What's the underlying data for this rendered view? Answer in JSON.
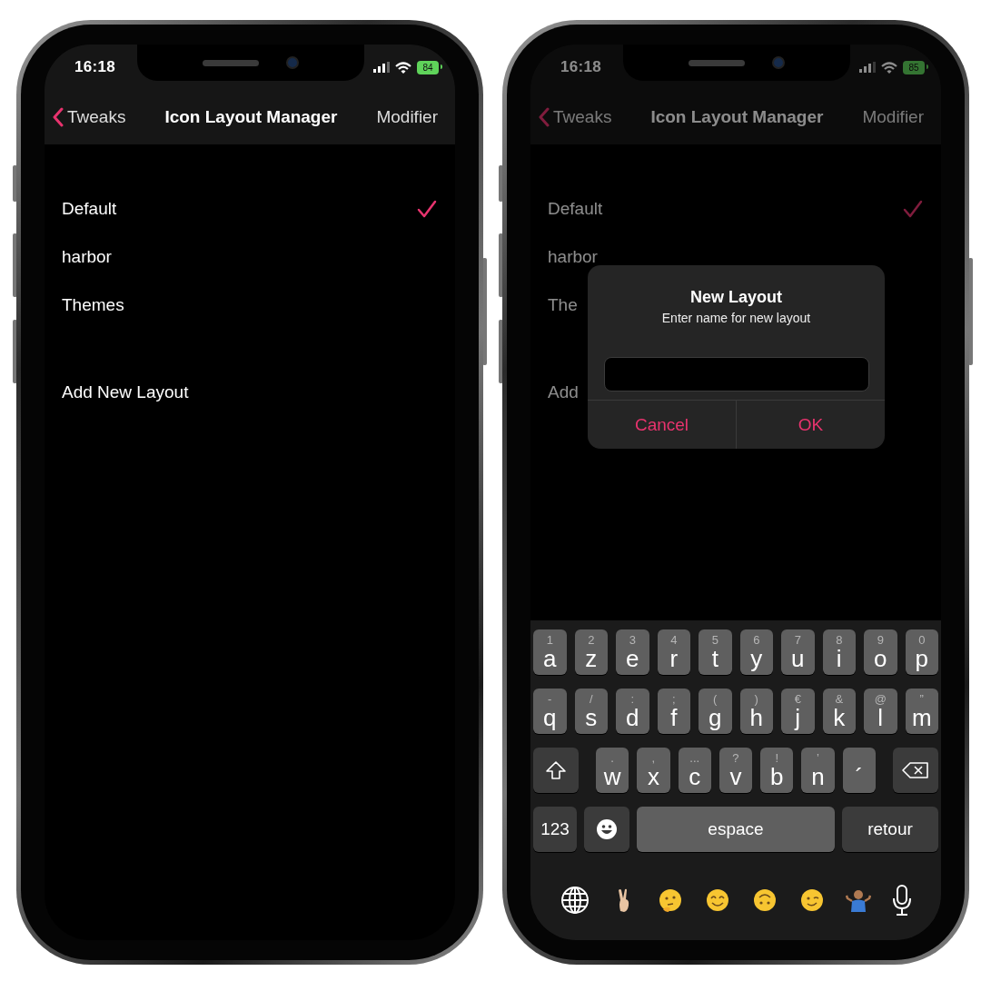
{
  "phones": [
    {
      "dimmed": false,
      "status_bar": {
        "time": "16:18",
        "battery": "84"
      },
      "nav": {
        "back": "Tweaks",
        "title": "Icon Layout Manager",
        "action": "Modifier"
      },
      "layouts": [
        {
          "label": "Default",
          "selected": true
        },
        {
          "label": "harbor",
          "selected": false
        },
        {
          "label": "Themes",
          "selected": false
        }
      ],
      "add_layout": "Add New Layout"
    },
    {
      "dimmed": true,
      "status_bar": {
        "time": "16:18",
        "battery": "85"
      },
      "nav": {
        "back": "Tweaks",
        "title": "Icon Layout Manager",
        "action": "Modifier"
      },
      "layouts": [
        {
          "label": "Default",
          "selected": true
        },
        {
          "label": "harbor",
          "selected": false
        },
        {
          "label": "The",
          "selected": false
        }
      ],
      "add_layout": "Add",
      "dialog": {
        "title": "New Layout",
        "message": "Enter name for new layout",
        "buttons": [
          "Cancel",
          "OK"
        ]
      },
      "keyboard": {
        "rows": [
          {
            "keys": [
              {
                "kind": "letter",
                "label": "a",
                "hint": "1"
              },
              {
                "kind": "letter",
                "label": "z",
                "hint": "2"
              },
              {
                "kind": "letter",
                "label": "e",
                "hint": "3"
              },
              {
                "kind": "letter",
                "label": "r",
                "hint": "4"
              },
              {
                "kind": "letter",
                "label": "t",
                "hint": "5"
              },
              {
                "kind": "letter",
                "label": "y",
                "hint": "6"
              },
              {
                "kind": "letter",
                "label": "u",
                "hint": "7"
              },
              {
                "kind": "letter",
                "label": "i",
                "hint": "8"
              },
              {
                "kind": "letter",
                "label": "o",
                "hint": "9"
              },
              {
                "kind": "letter",
                "label": "p",
                "hint": "0"
              }
            ]
          },
          {
            "keys": [
              {
                "kind": "letter",
                "label": "q",
                "hint": "-"
              },
              {
                "kind": "letter",
                "label": "s",
                "hint": "/"
              },
              {
                "kind": "letter",
                "label": "d",
                "hint": ":"
              },
              {
                "kind": "letter",
                "label": "f",
                "hint": ";"
              },
              {
                "kind": "letter",
                "label": "g",
                "hint": "("
              },
              {
                "kind": "letter",
                "label": "h",
                "hint": ")"
              },
              {
                "kind": "letter",
                "label": "j",
                "hint": "€"
              },
              {
                "kind": "letter",
                "label": "k",
                "hint": "&"
              },
              {
                "kind": "letter",
                "label": "l",
                "hint": "@"
              },
              {
                "kind": "letter",
                "label": "m",
                "hint": "”"
              }
            ]
          },
          {
            "keys": [
              {
                "kind": "shift"
              },
              {
                "kind": "letter",
                "label": "w",
                "hint": "."
              },
              {
                "kind": "letter",
                "label": "x",
                "hint": ","
              },
              {
                "kind": "letter",
                "label": "c",
                "hint": "..."
              },
              {
                "kind": "letter",
                "label": "v",
                "hint": "?"
              },
              {
                "kind": "letter",
                "label": "b",
                "hint": "!"
              },
              {
                "kind": "letter",
                "label": "n",
                "hint": "’"
              },
              {
                "kind": "letter",
                "label": "´"
              },
              {
                "kind": "delete"
              }
            ]
          },
          {
            "keys": [
              {
                "kind": "numbers",
                "label": "123"
              },
              {
                "kind": "emoji"
              },
              {
                "kind": "space",
                "label": "espace"
              },
              {
                "kind": "return",
                "label": "retour"
              }
            ]
          }
        ]
      }
    }
  ]
}
